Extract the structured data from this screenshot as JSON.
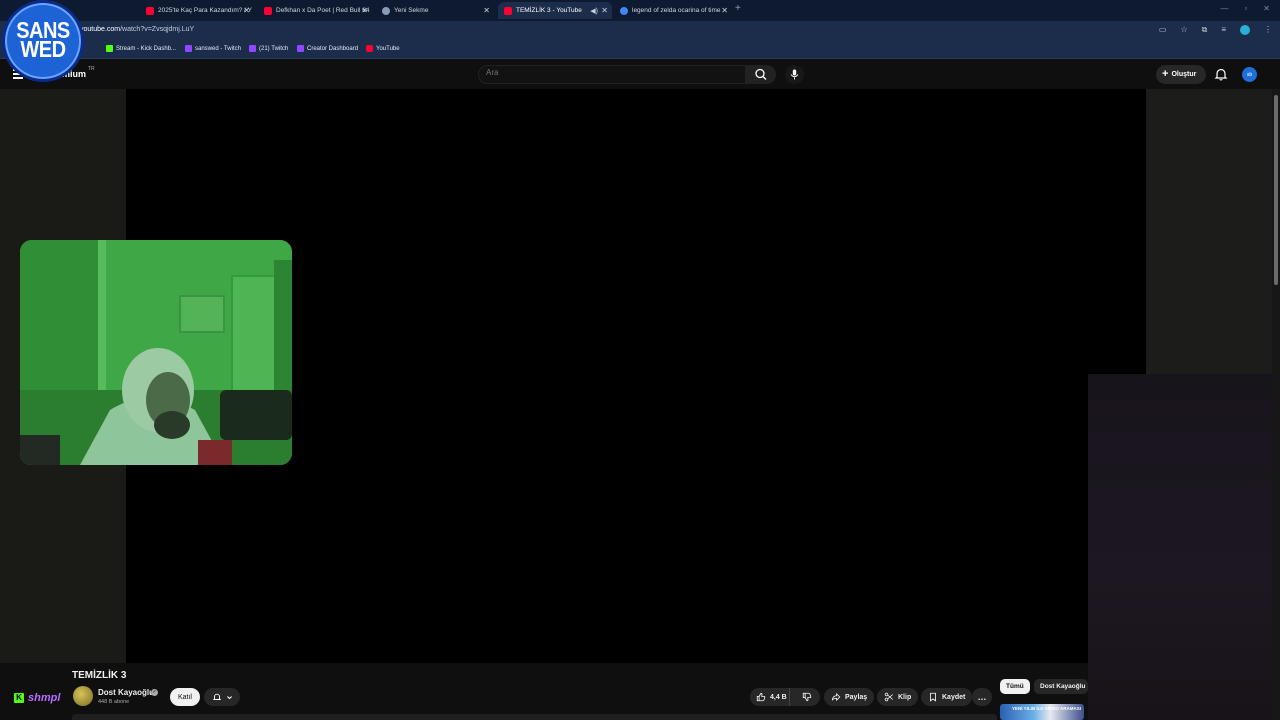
{
  "browser": {
    "tabs": [
      {
        "label": "2025'te Kaç Para Kazandım? / Y",
        "favicon_color": "#ff0033",
        "active": false
      },
      {
        "label": "Defkhan x Da Poet | Red Bull 64",
        "favicon_color": "#ff0033",
        "active": false
      },
      {
        "label": "Yeni Sekme",
        "favicon_color": "#8a9bb8",
        "active": false
      },
      {
        "label": "TEMİZLİK 3 - YouTube",
        "favicon_color": "#ff0033",
        "active": true
      },
      {
        "label": "legend of zelda ocarina of time",
        "favicon_color": "#4285f4",
        "active": false
      }
    ],
    "new_tab_label": "+",
    "url_domain": "youtube.com",
    "url_path": "/watch?v=Zvsqjdmj.LuY",
    "bookmarks": [
      {
        "label": "Stream - Kick Dashb...",
        "icon_color": "#53fc18"
      },
      {
        "label": "sanswed - Twitch",
        "icon_color": "#9146ff"
      },
      {
        "label": "(21) Twitch",
        "icon_color": "#9146ff"
      },
      {
        "label": "Creator Dashboard",
        "icon_color": "#9146ff"
      },
      {
        "label": "YouTube",
        "icon_color": "#ff0033"
      }
    ]
  },
  "overlay": {
    "logo_line1": "SANS",
    "logo_line2": "WED",
    "kick_user": "shmpl"
  },
  "youtube": {
    "logo_text": "mium",
    "logo_region": "TR",
    "search_placeholder": "Ara",
    "create_label": "Oluştur",
    "avatar_initials": "sb",
    "video_title": "TEMİZLİK 3",
    "channel_name": "Dost Kayaoğlu",
    "subscribers": "448 B abone",
    "join_label": "Katıl",
    "likes": "4,4 B",
    "share_label": "Paylaş",
    "clip_label": "Klip",
    "save_label": "Kaydet",
    "more_label": "…",
    "chips": [
      "Tümü",
      "Dost Kayaoğlu"
    ],
    "recommended_thumb_text": "YENİ YILIN İLK VİDEO ARAMASI"
  },
  "colors": {
    "accent": "#ff0033",
    "tabbar_bg": "#0d1a2f",
    "toolbar_bg": "#1b2d4b",
    "page_bg": "#0f0f0f",
    "kick_green": "#53fc18"
  }
}
